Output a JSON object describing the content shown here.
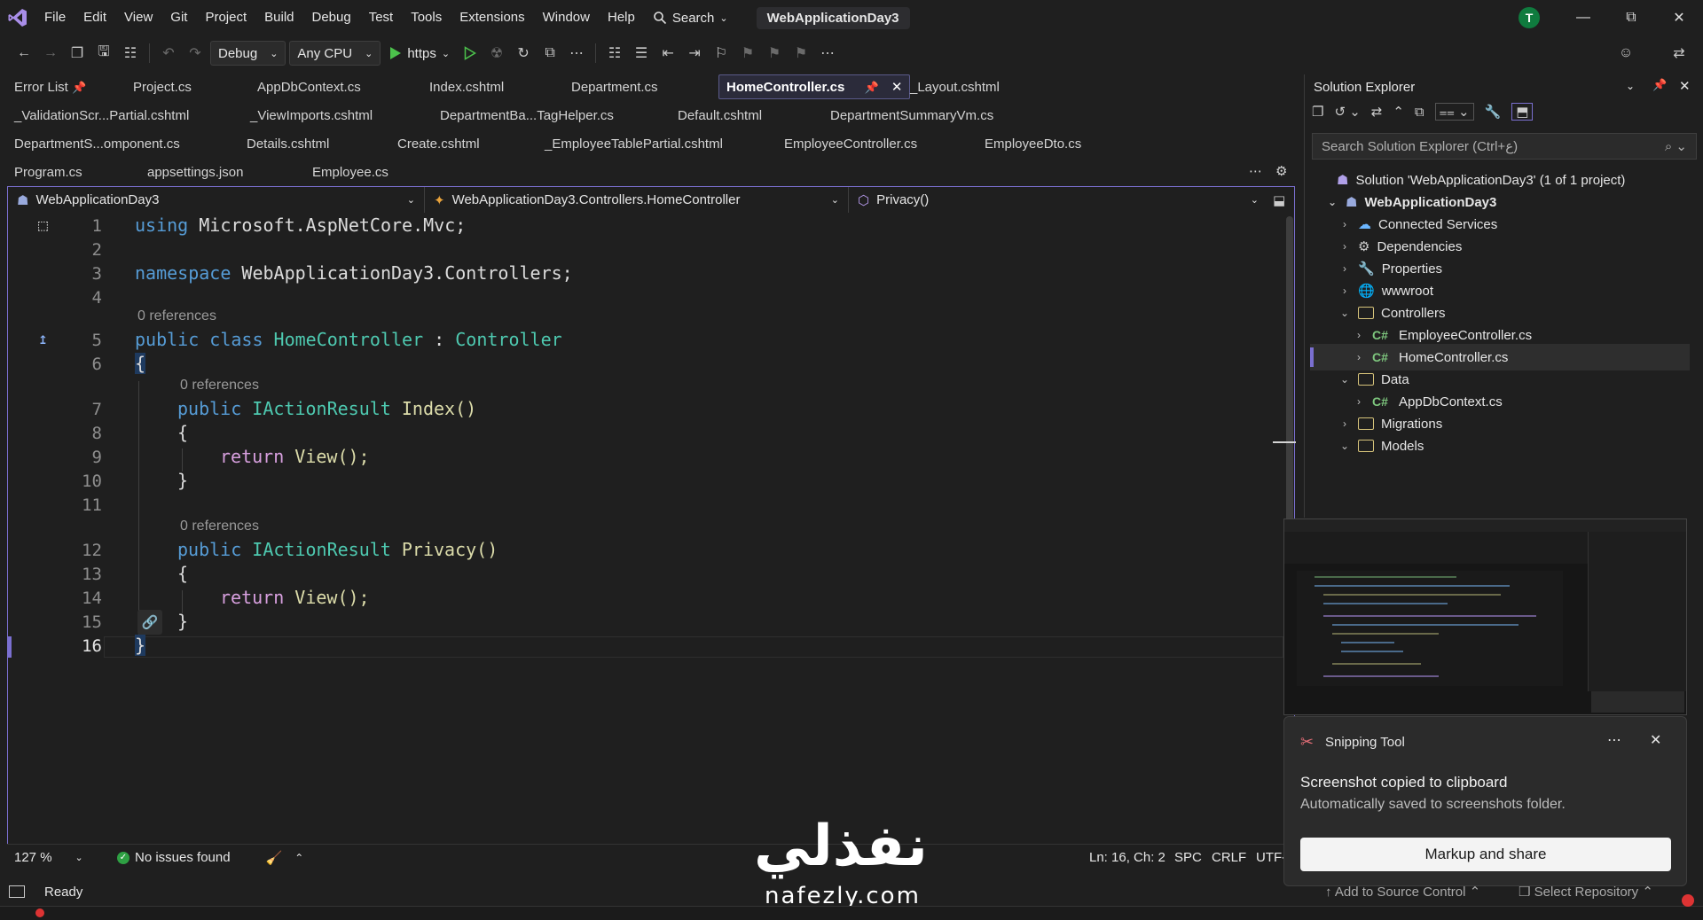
{
  "menu": {
    "items": [
      "File",
      "Edit",
      "View",
      "Git",
      "Project",
      "Build",
      "Debug",
      "Test",
      "Tools",
      "Extensions",
      "Window",
      "Help"
    ],
    "search_label": "Search",
    "solution_title": "WebApplicationDay3",
    "avatar_initial": "T"
  },
  "toolbar": {
    "config": "Debug",
    "platform": "Any CPU",
    "run_target": "https"
  },
  "tabs": {
    "row1": [
      "Error List",
      "Project.cs",
      "AppDbContext.cs",
      "Index.cshtml",
      "Department.cs",
      "HomeController.cs",
      "_Layout.cshtml"
    ],
    "row2": [
      "_ValidationScr...Partial.cshtml",
      "_ViewImports.cshtml",
      "DepartmentBa...TagHelper.cs",
      "Default.cshtml",
      "DepartmentSummaryVm.cs"
    ],
    "row3": [
      "DepartmentS...omponent.cs",
      "Details.cshtml",
      "Create.cshtml",
      "_EmployeeTablePartial.cshtml",
      "EmployeeController.cs",
      "EmployeeDto.cs"
    ],
    "row4": [
      "Program.cs",
      "appsettings.json",
      "Employee.cs"
    ],
    "active": "HomeController.cs"
  },
  "navbar": {
    "project": "WebApplicationDay3",
    "class": "WebApplicationDay3.Controllers.HomeController",
    "member": "Privacy()"
  },
  "code": {
    "line_numbers": [
      "1",
      "2",
      "3",
      "4",
      "5",
      "6",
      "7",
      "8",
      "9",
      "10",
      "11",
      "12",
      "13",
      "14",
      "15",
      "16"
    ],
    "references": "0 references",
    "using_kw": "using",
    "using_ns": "Microsoft.AspNetCore.Mvc;",
    "namespace_kw": "namespace",
    "namespace_name": "WebApplicationDay3.Controllers;",
    "class_mods": "public class",
    "class_name": "HomeController",
    "class_sep": ":",
    "base_class": "Controller",
    "open_brace": "{",
    "close_brace": "}",
    "public_kw": "public",
    "return_type": "IActionResult",
    "method_index": "Index()",
    "method_privacy": "Privacy()",
    "return_kw": "return",
    "return_call": "View();"
  },
  "editor_status": {
    "zoom": "127 %",
    "issues": "No issues found",
    "position": "Ln: 16, Ch: 2",
    "whitespace": "SPC",
    "line_ending": "CRLF",
    "encoding": "UTF-"
  },
  "statusbar": {
    "ready": "Ready",
    "add_source": "Add to Source Control",
    "select_repo": "Select Repository"
  },
  "solution_explorer": {
    "title": "Solution Explorer",
    "search_placeholder": "Search Solution Explorer (Ctrl+ع)",
    "items": [
      {
        "label": "Solution 'WebApplicationDay3' (1 of 1 project)"
      },
      {
        "label": "WebApplicationDay3"
      },
      {
        "label": "Connected Services"
      },
      {
        "label": "Dependencies"
      },
      {
        "label": "Properties"
      },
      {
        "label": "wwwroot"
      },
      {
        "label": "Controllers"
      },
      {
        "label": "EmployeeController.cs"
      },
      {
        "label": "HomeController.cs"
      },
      {
        "label": "Data"
      },
      {
        "label": "AppDbContext.cs"
      },
      {
        "label": "Migrations"
      },
      {
        "label": "Models"
      }
    ]
  },
  "snipping": {
    "app_name": "Snipping Tool",
    "message": "Screenshot copied to clipboard",
    "detail": "Automatically saved to screenshots folder.",
    "action": "Markup and share"
  },
  "watermark": {
    "arabic": "نفذلي",
    "latin": "nafezly.com"
  },
  "colors": {
    "accent": "#7a6fd0",
    "keyword": "#569cd6",
    "control_keyword": "#d8a0df",
    "type": "#4ec9b0",
    "method": "#dcdcaa"
  }
}
